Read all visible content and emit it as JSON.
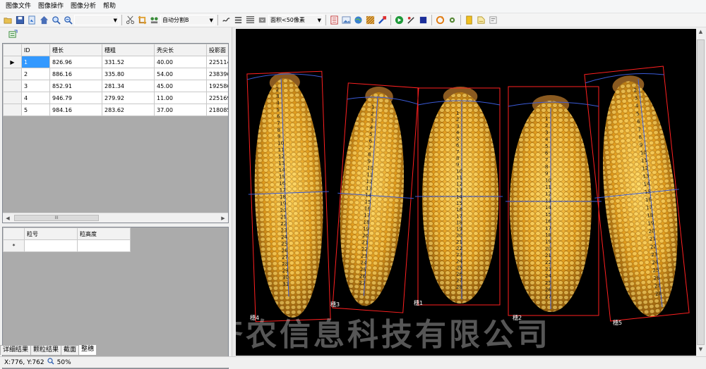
{
  "menu": [
    "图像文件",
    "图像操作",
    "图像分析",
    "帮助"
  ],
  "toolbar": {
    "combo1_value": "",
    "segment_mode": "自动分割B",
    "area_filter": "面积<50像素"
  },
  "results_table": {
    "columns": [
      "ID",
      "穗长",
      "穗粗",
      "秃尖长",
      "投影面"
    ],
    "rows": [
      [
        "1",
        "826.96",
        "331.52",
        "40.00",
        "225114."
      ],
      [
        "2",
        "886.16",
        "335.80",
        "54.00",
        "238396."
      ],
      [
        "3",
        "852.91",
        "281.34",
        "45.00",
        "192586."
      ],
      [
        "4",
        "946.79",
        "279.92",
        "11.00",
        "225169."
      ],
      [
        "5",
        "984.16",
        "283.62",
        "37.00",
        "218085."
      ]
    ],
    "scroll_glyph": "III"
  },
  "kernel_table": {
    "columns": [
      "粒号",
      "粒高度"
    ],
    "new_row_marker": "*"
  },
  "tabs": [
    "详细结果",
    "颗粒结果",
    "截面",
    "整穗"
  ],
  "active_tab": 3,
  "status": {
    "coords": "X:776, Y:762",
    "zoom": "50%"
  },
  "image": {
    "ear_labels": [
      "穗4",
      "穗3",
      "穗1",
      "穗2",
      "穗5"
    ],
    "watermark": "山东齐农信息科技有限公司",
    "colors": {
      "box": "#ff2020",
      "axis": "#3b5bd8",
      "kernel": "#e0a21c"
    },
    "scale_numbers_ear4": [
      "2",
      "3",
      "4",
      "5",
      "6",
      "7",
      "8",
      "9",
      "10",
      "11",
      "12",
      "13",
      "14",
      "15",
      "16",
      "17",
      "18",
      "19",
      "20",
      "21",
      "22",
      "23",
      "24",
      "25",
      "26",
      "27",
      "28",
      "29",
      "30",
      "31"
    ],
    "scale_numbers_ear3": [
      "1",
      "2",
      "3",
      "4",
      "5",
      "6",
      "7",
      "8",
      "9",
      "10",
      "11",
      "12",
      "13",
      "14",
      "15",
      "16",
      "17",
      "18",
      "19",
      "20",
      "21",
      "22",
      "23",
      "24",
      "25",
      "26",
      "27"
    ],
    "scale_numbers_ear1": [
      "1",
      "2",
      "3",
      "4",
      "5",
      "6",
      "7",
      "8",
      "9",
      "10",
      "11",
      "12",
      "13",
      "14",
      "15",
      "16",
      "17",
      "18",
      "19",
      "20",
      "21",
      "22",
      "23",
      "24",
      "25",
      "26",
      "27",
      "28"
    ],
    "scale_numbers_ear2": [
      "1",
      "2",
      "3",
      "4",
      "5",
      "6",
      "7",
      "8",
      "9",
      "10",
      "11",
      "12",
      "13",
      "14",
      "15",
      "16",
      "17",
      "18",
      "19",
      "20",
      "21",
      "22",
      "23",
      "24",
      "25",
      "26",
      "27"
    ],
    "scale_numbers_ear5": [
      "2",
      "3",
      "4",
      "5",
      "6",
      "7",
      "8",
      "9",
      "10",
      "11",
      "12",
      "13",
      "14",
      "15",
      "16",
      "17",
      "18",
      "19",
      "20",
      "21",
      "22",
      "23",
      "24",
      "25",
      "26",
      "27",
      "28"
    ]
  }
}
